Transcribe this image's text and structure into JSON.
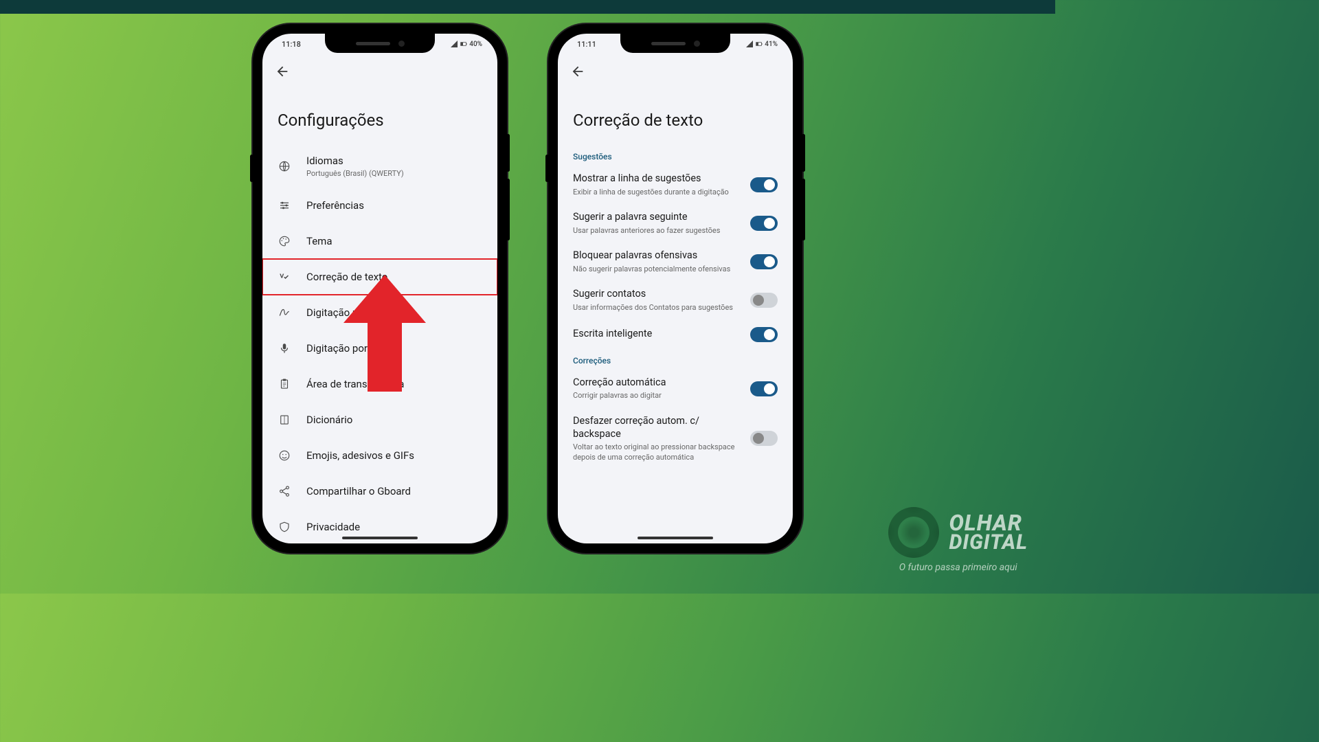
{
  "phone1": {
    "status": {
      "time": "11:18",
      "battery": "40%"
    },
    "title": "Configurações",
    "items": [
      {
        "icon": "globe",
        "title": "Idiomas",
        "sub": "Português (Brasil) (QWERTY)"
      },
      {
        "icon": "sliders",
        "title": "Preferências"
      },
      {
        "icon": "palette",
        "title": "Tema"
      },
      {
        "icon": "spellcheck",
        "title": "Correção de texto",
        "highlighted": true
      },
      {
        "icon": "gesture",
        "title": "Digitação por gesto"
      },
      {
        "icon": "mic",
        "title": "Digitação por Voz"
      },
      {
        "icon": "clipboard",
        "title": "Área de transferência"
      },
      {
        "icon": "book",
        "title": "Dicionário"
      },
      {
        "icon": "emoji",
        "title": "Emojis, adesivos e GIFs"
      },
      {
        "icon": "share",
        "title": "Compartilhar o Gboard"
      },
      {
        "icon": "shield",
        "title": "Privacidade"
      }
    ]
  },
  "phone2": {
    "status": {
      "time": "11:11",
      "battery": "41%"
    },
    "title": "Correção de texto",
    "sections": [
      {
        "label": "Sugestões",
        "toggles": [
          {
            "title": "Mostrar a linha de sugestões",
            "sub": "Exibir a linha de sugestões durante a digitação",
            "on": true
          },
          {
            "title": "Sugerir a palavra seguinte",
            "sub": "Usar palavras anteriores ao fazer sugestões",
            "on": true
          },
          {
            "title": "Bloquear palavras ofensivas",
            "sub": "Não sugerir palavras potencialmente ofensivas",
            "on": true
          },
          {
            "title": "Sugerir contatos",
            "sub": "Usar informações dos Contatos para sugestões",
            "on": false
          },
          {
            "title": "Escrita inteligente",
            "sub": "",
            "on": true
          }
        ]
      },
      {
        "label": "Correções",
        "toggles": [
          {
            "title": "Correção automática",
            "sub": "Corrigir palavras ao digitar",
            "on": true
          },
          {
            "title": "Desfazer correção autom. c/ backspace",
            "sub": "Voltar ao texto original ao pressionar backspace depois de uma correção automática",
            "on": false
          }
        ]
      }
    ]
  },
  "brand": {
    "line1": "OLHAR",
    "line2": "DIGITAL",
    "tagline": "O futuro passa primeiro aqui"
  }
}
